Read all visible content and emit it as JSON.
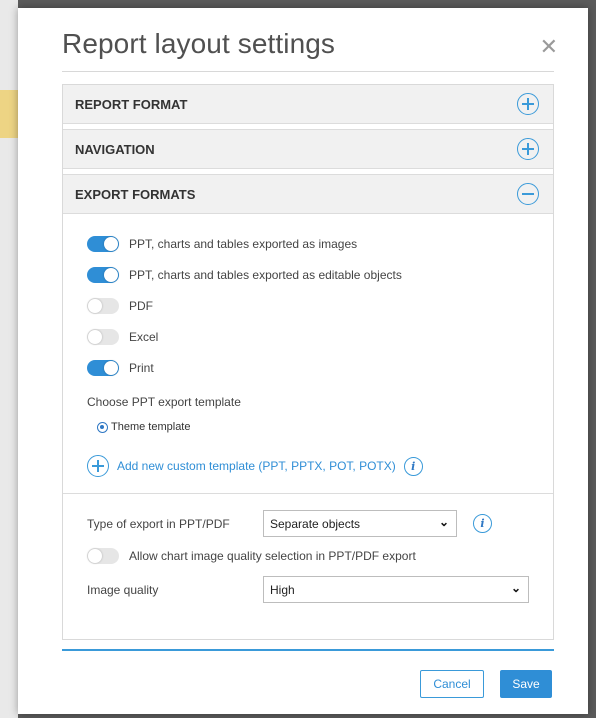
{
  "dialog": {
    "title": "Report layout settings",
    "close_glyph": "✕"
  },
  "sections": [
    {
      "label": "REPORT FORMAT",
      "state": "collapsed",
      "icon": "plus-circle-icon"
    },
    {
      "label": "NAVIGATION",
      "state": "collapsed",
      "icon": "plus-circle-icon"
    },
    {
      "label": "EXPORT FORMATS",
      "state": "expanded",
      "icon": "minus-circle-icon"
    }
  ],
  "export_formats": {
    "toggles": [
      {
        "label": "PPT, charts and tables exported as images",
        "on": true
      },
      {
        "label": "PPT, charts and tables exported as editable objects",
        "on": true
      },
      {
        "label": "PDF",
        "on": false
      },
      {
        "label": "Excel",
        "on": false
      },
      {
        "label": "Print",
        "on": true
      }
    ],
    "template_label": "Choose PPT export template",
    "template_option": "Theme template",
    "add_template_label": "Add new custom template (PPT, PPTX, POT, POTX)",
    "info_glyph": "i"
  },
  "ppt_pdf": {
    "export_type_label": "Type of export in PPT/PDF",
    "export_type_value": "Separate objects",
    "quality_selection_label": "Allow chart image quality selection in PPT/PDF export",
    "quality_selection_on": false,
    "image_quality_label": "Image quality",
    "image_quality_value": "High",
    "chevron_glyph": "⌄"
  },
  "footer": {
    "cancel_label": "Cancel",
    "save_label": "Save"
  },
  "colors": {
    "accent": "#2f8ed6",
    "section_bg": "#f1f1f1"
  }
}
